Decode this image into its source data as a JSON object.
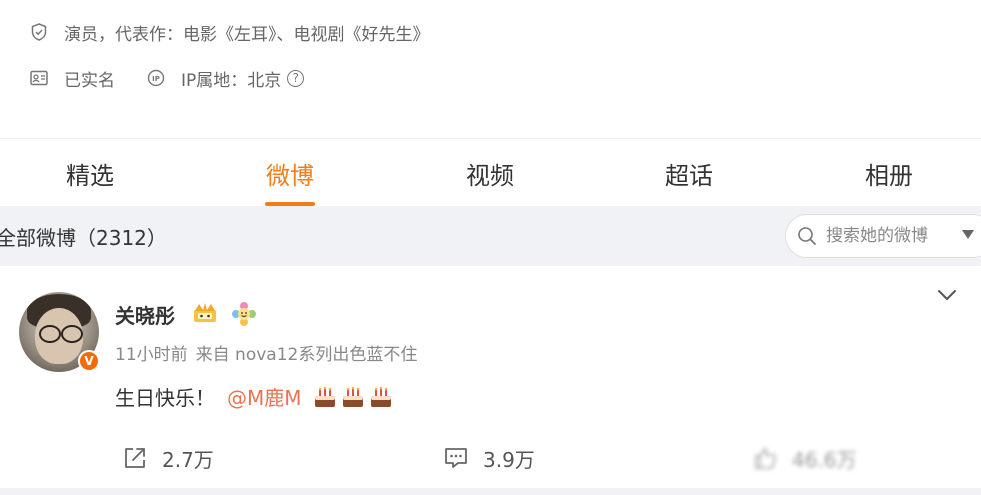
{
  "profile": {
    "description_label": "演员，代表作：电影《左耳》、电视剧《好先生》",
    "verified_label": "已实名",
    "ip_label": "IP属地：北京",
    "help_glyph": "?"
  },
  "tabs": [
    {
      "label": "精选",
      "active": false
    },
    {
      "label": "微博",
      "active": true
    },
    {
      "label": "视频",
      "active": false
    },
    {
      "label": "超话",
      "active": false
    },
    {
      "label": "相册",
      "active": false
    }
  ],
  "filter": {
    "title": "全部微博（2312）",
    "search_placeholder": "搜索她的微博"
  },
  "post": {
    "username": "关晓彤",
    "verified_mark": "V",
    "time": "11小时前",
    "source": "来自 nova12系列出色蓝不住",
    "text": "生日快乐！",
    "mention": "@M鹿M",
    "repost_count": "2.7万",
    "comment_count": "3.9万",
    "like_count": "46.6万"
  },
  "colors": {
    "accent": "#f27d19",
    "mention": "#eb7350",
    "badge": "#f26c0b",
    "filter_bg": "#f1f2f5"
  },
  "icons": [
    "shield-icon",
    "id-card-icon",
    "ip-icon",
    "help-icon",
    "search-icon",
    "caret-down-icon",
    "chevron-down-icon",
    "crown-badge-icon",
    "flower-badge-icon",
    "cake-icon",
    "repost-icon",
    "comment-icon",
    "like-icon"
  ]
}
